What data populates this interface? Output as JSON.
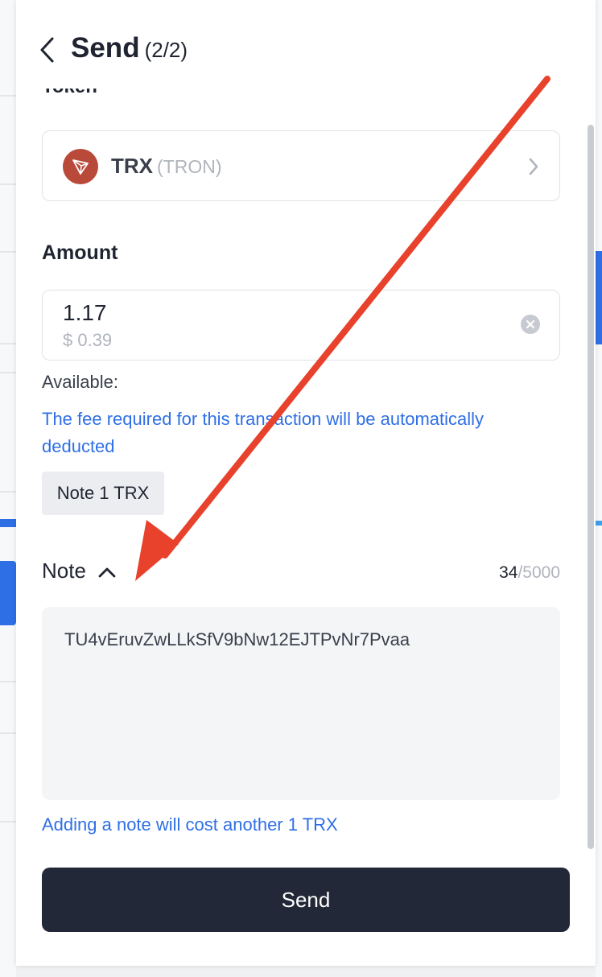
{
  "header": {
    "title": "Send",
    "step": "(2/2)"
  },
  "token": {
    "label": "Token",
    "symbol": "TRX",
    "network": "(TRON)"
  },
  "amount": {
    "label": "Amount",
    "value": "1.17",
    "usd_value": "$ 0.39",
    "available_label": "Available:",
    "fee_message": "The fee required for this transaction will be automatically deducted",
    "fee_chip": "Note 1 TRX"
  },
  "note": {
    "label": "Note",
    "count_current": "34",
    "count_separator": "/",
    "count_max": "5000",
    "text": "TU4vEruvZwLLkSfV9bNw12EJTPvNr7Pvaa",
    "cost_message": "Adding a note will cost another 1 TRX"
  },
  "footer": {
    "send_label": "Send"
  },
  "colors": {
    "accent_blue": "#2f6fe6",
    "send_button": "#232838",
    "tron_logo": "#b94a3a",
    "annotation_arrow": "#e8412c"
  },
  "icons": {
    "back": "chevron-left-icon",
    "token": "tron-logo-icon",
    "select": "chevron-right-icon",
    "clear": "clear-icon",
    "note_toggle": "chevron-up-icon"
  }
}
